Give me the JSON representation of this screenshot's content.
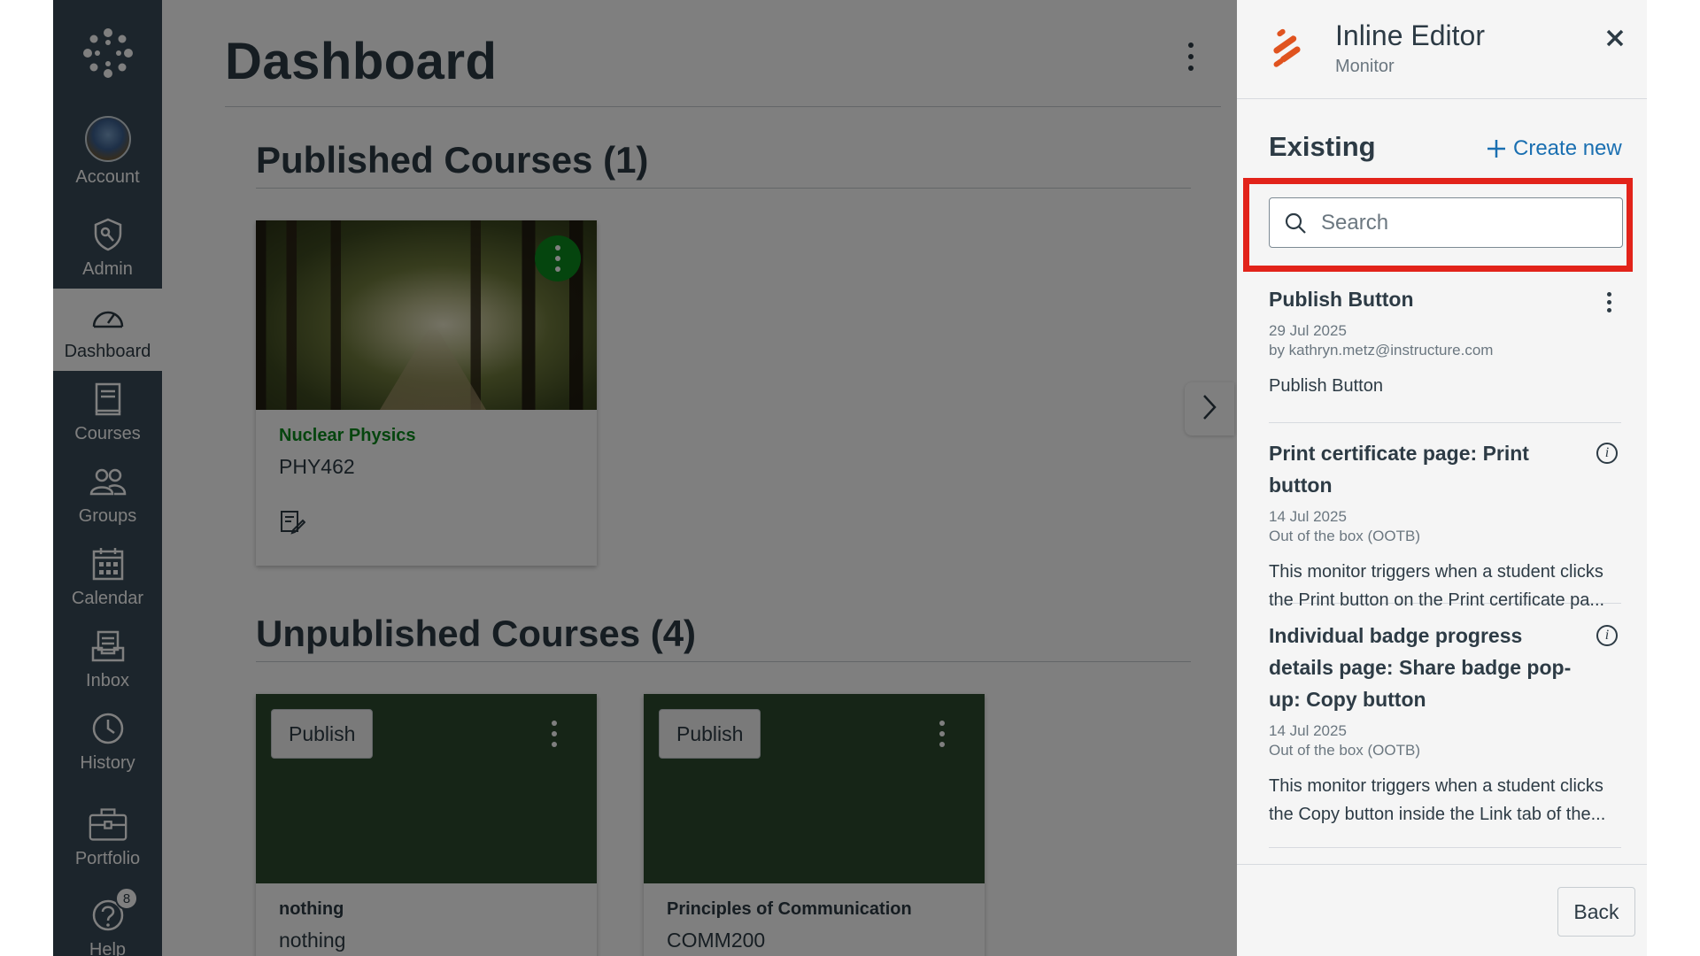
{
  "global_nav": {
    "items": [
      {
        "label": "Account",
        "icon": "avatar"
      },
      {
        "label": "Admin",
        "icon": "shield-wrench-icon"
      },
      {
        "label": "Dashboard",
        "icon": "speedometer-icon"
      },
      {
        "label": "Courses",
        "icon": "book-icon"
      },
      {
        "label": "Groups",
        "icon": "people-icon"
      },
      {
        "label": "Calendar",
        "icon": "calendar-icon"
      },
      {
        "label": "Inbox",
        "icon": "inbox-icon"
      },
      {
        "label": "History",
        "icon": "clock-icon"
      },
      {
        "label": "Portfolio",
        "icon": "briefcase-icon"
      },
      {
        "label": "Help",
        "icon": "question-icon",
        "badge": "8"
      }
    ],
    "active": "Dashboard"
  },
  "dashboard": {
    "title": "Dashboard",
    "published_heading": "Published Courses (1)",
    "unpublished_heading": "Unpublished Courses (4)",
    "published_courses": [
      {
        "name": "Nuclear Physics",
        "code": "PHY462",
        "accent": "#0b8a1c"
      }
    ],
    "unpublished_courses": [
      {
        "name": "nothing",
        "code": "nothing",
        "publish_label": "Publish"
      },
      {
        "name": "Principles of Communication",
        "code": "COMM200",
        "publish_label": "Publish"
      }
    ]
  },
  "panel": {
    "title": "Inline Editor",
    "subtitle": "Monitor",
    "existing_label": "Existing",
    "create_new_label": "Create new",
    "search_placeholder": "Search",
    "highlight_color": "#e2231a",
    "monitors": [
      {
        "title": "Publish Button",
        "date": "29 Jul 2025",
        "by": "by kathryn.metz@instructure.com",
        "description": "Publish Button"
      },
      {
        "title": "Print certificate page: Print button",
        "date": "14 Jul 2025",
        "by": "Out of the box (OOTB)",
        "description": "This monitor triggers when a student clicks the Print button on the Print certificate pa..."
      },
      {
        "title": "Individual badge progress details page: Share badge pop-up: Copy button",
        "date": "14 Jul 2025",
        "by": "Out of the box (OOTB)",
        "description": "This monitor triggers when a student clicks the Copy button inside the Link tab of the..."
      }
    ],
    "back_label": "Back"
  }
}
